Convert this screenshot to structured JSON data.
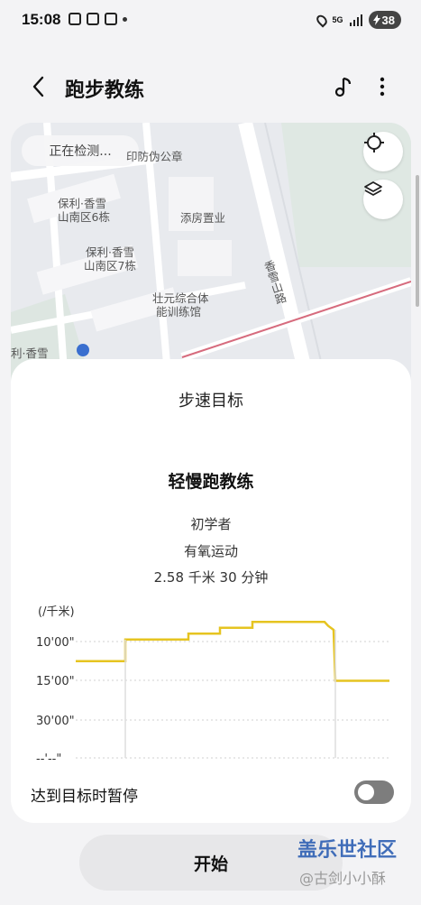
{
  "status_bar": {
    "time": "15:08",
    "network": "5G",
    "battery": "38"
  },
  "header": {
    "title": "跑步教练"
  },
  "map": {
    "detecting": "正在检测...",
    "labels": [
      "印防伪公章",
      "保利·香雪",
      "山南区6栋",
      "添房置业",
      "保利·香雪",
      "山南区7栋",
      "香雪山路",
      "壮元综合体",
      "能训练馆",
      "利·香雪"
    ]
  },
  "card": {
    "heading": "步速目标",
    "coach_name": "轻慢跑教练",
    "level": "初学者",
    "mode": "有氧运动",
    "summary": "2.58 千米 30 分钟",
    "pause_label": "达到目标时暂停",
    "pause_enabled": false
  },
  "chart_data": {
    "type": "line",
    "ylabel": "(/千米)",
    "y_ticks": [
      "10'00\"",
      "15'00\"",
      "30'00\"",
      "--'--\""
    ],
    "series": [
      {
        "values": [
          15,
          15,
          9.5,
          9.5,
          8,
          8,
          6.5,
          6.5,
          5,
          5,
          6,
          7,
          20,
          20
        ]
      }
    ],
    "colors": {
      "line": "#e6c420",
      "grid": "#d0d0d0"
    }
  },
  "actions": {
    "start": "开始"
  },
  "watermark": {
    "line1": "盖乐世社区",
    "line2": "@古剑小小酥"
  }
}
